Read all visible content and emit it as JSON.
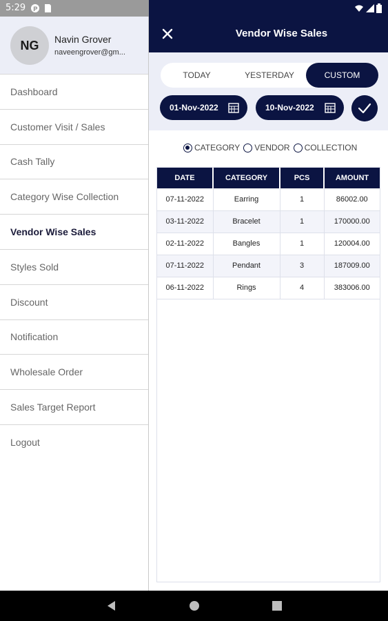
{
  "status_bar": {
    "time": "5:29"
  },
  "drawer": {
    "avatar_initials": "NG",
    "user_name": "Navin Grover",
    "user_email": "naveengrover@gm...",
    "menu": [
      {
        "label": "Dashboard"
      },
      {
        "label": "Customer Visit / Sales"
      },
      {
        "label": "Cash Tally"
      },
      {
        "label": "Category Wise Collection"
      },
      {
        "label": "Vendor Wise Sales"
      },
      {
        "label": "Styles Sold"
      },
      {
        "label": "Discount"
      },
      {
        "label": "Notification"
      },
      {
        "label": "Wholesale Order"
      },
      {
        "label": "Sales Target Report"
      },
      {
        "label": "Logout"
      }
    ],
    "active_index": 4
  },
  "appbar": {
    "title": "Vendor Wise Sales"
  },
  "filters": {
    "tabs": [
      "TODAY",
      "YESTERDAY",
      "CUSTOM"
    ],
    "active_tab": "CUSTOM",
    "from_date": "01-Nov-2022",
    "to_date": "10-Nov-2022"
  },
  "group_by": {
    "options": [
      "CATEGORY",
      "VENDOR",
      "COLLECTION"
    ],
    "selected": "CATEGORY"
  },
  "table": {
    "headers": [
      "DATE",
      "CATEGORY",
      "PCS",
      "AMOUNT"
    ],
    "rows": [
      [
        "07-11-2022",
        "Earring",
        "1",
        "86002.00"
      ],
      [
        "03-11-2022",
        "Bracelet",
        "1",
        "170000.00"
      ],
      [
        "02-11-2022",
        "Bangles",
        "1",
        "120004.00"
      ],
      [
        "07-11-2022",
        "Pendant",
        "3",
        "187009.00"
      ],
      [
        "06-11-2022",
        "Rings",
        "4",
        "383006.00"
      ]
    ]
  },
  "colors": {
    "primary": "#0b1442",
    "panel": "#eceef7"
  },
  "icons": [
    "close-icon",
    "calendar-icon",
    "check-icon",
    "wifi-icon",
    "signal-icon",
    "battery-icon",
    "back-icon",
    "home-icon",
    "recents-icon"
  ]
}
